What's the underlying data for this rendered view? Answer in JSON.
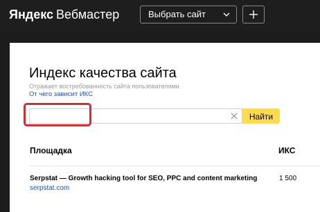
{
  "header": {
    "logo_brand": "Яндекс",
    "logo_product": "Вебмастер",
    "site_select_label": "Выбрать сайт",
    "add_site_icon": "plus-icon",
    "dropdown_icon": "chevron-down-icon"
  },
  "page": {
    "title": "Индекс качества сайта",
    "subtitle": "Отражает востребованность сайта пользователями.",
    "help_link": "От чего зависит ИКС"
  },
  "search": {
    "value": "",
    "placeholder": "",
    "clear_icon": "close-icon",
    "button_label": "Найти"
  },
  "table": {
    "columns": [
      "Площадка",
      "ИКС"
    ],
    "rows": [
      {
        "title": "Serpstat — Growth hacking tool for SEO, PPC and content marketing",
        "url": "serpstat.com",
        "iks": "1 500"
      }
    ]
  },
  "colors": {
    "header_bg": "#1e1e1e",
    "accent_yellow": "#ffdb4d",
    "link_blue": "#1f4fa8",
    "highlight_red": "#c8303a"
  }
}
